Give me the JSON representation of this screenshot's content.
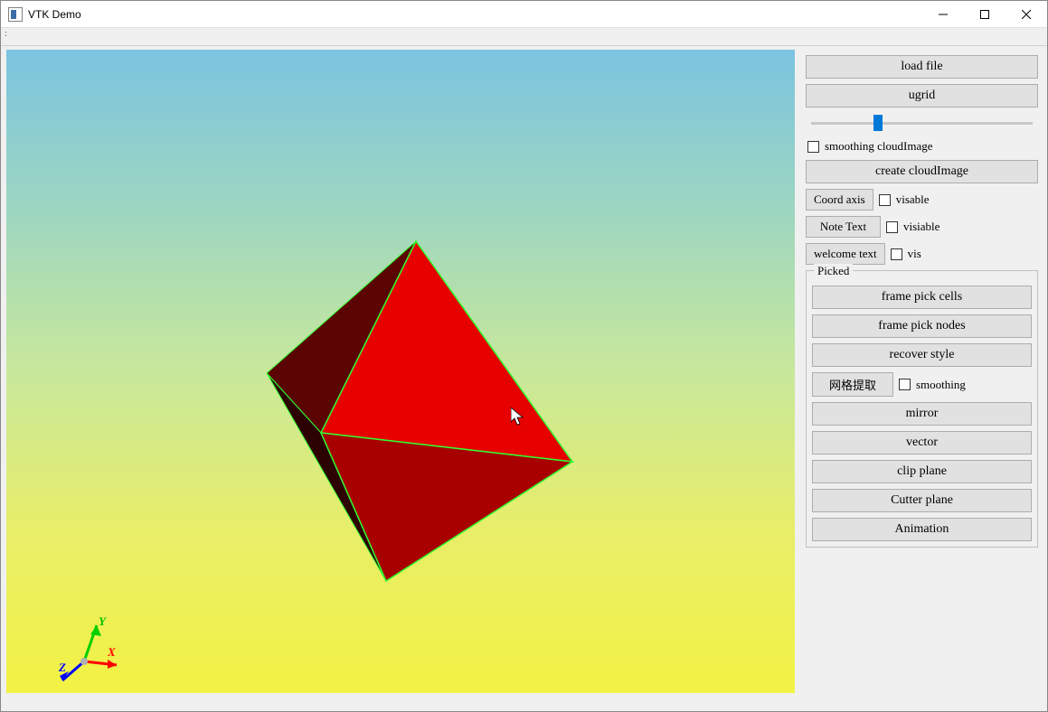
{
  "window": {
    "title": "VTK Demo"
  },
  "sidebar": {
    "load_file": "load file",
    "ugrid": "ugrid",
    "smoothing_cloud_label": "smoothing cloudImage",
    "create_cloud": "create cloudImage",
    "coord_axis_btn": "Coord axis",
    "coord_axis_check": "visable",
    "note_text_btn": "Note Text",
    "note_text_check": "visiable",
    "welcome_text_btn": "welcome text",
    "welcome_text_check": "vis",
    "picked_label": "Picked",
    "frame_pick_cells": "frame pick cells",
    "frame_pick_nodes": "frame pick nodes",
    "recover_style": "recover style",
    "mesh_extract_btn": "网格提取",
    "mesh_smoothing_check": "smoothing",
    "mirror": "mirror",
    "vector": "vector",
    "clip_plane": "clip  plane",
    "cutter_plane": "Cutter plane",
    "animation": "Animation"
  },
  "axis": {
    "x": "X",
    "y": "Y",
    "z": "Z"
  }
}
